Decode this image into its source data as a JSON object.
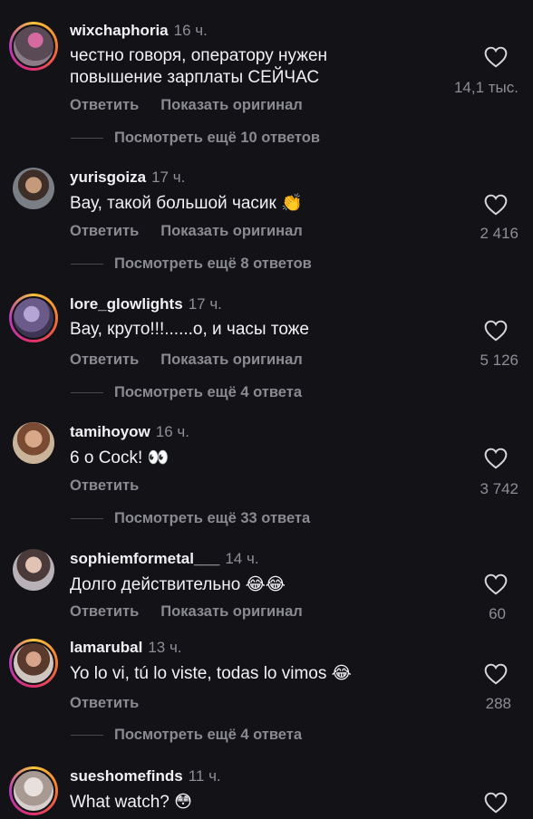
{
  "ui": {
    "reply_label": "Ответить",
    "show_original_label": "Показать оригинал"
  },
  "comments": [
    {
      "username": "wixchaphoria",
      "time": "16 ч.",
      "text": "честно говоря, оператору нужен",
      "text2": "повышение зарплаты СЕЙЧАС",
      "likes": "14,1 тыс.",
      "replies": "Посмотреть ещё 10 ответов"
    },
    {
      "username": "yurisgoiza",
      "time": "17 ч.",
      "text": "Вау, такой большой часик",
      "emoji": "👏",
      "likes": "2 416",
      "replies": "Посмотреть ещё 8 ответов"
    },
    {
      "username": "lore_glowlights",
      "time": "17 ч.",
      "text": "Вау, круто!!!......о, и часы тоже",
      "likes": "5 126",
      "replies": "Посмотреть ещё 4 ответа"
    },
    {
      "username": "tamihoyow",
      "time": "16 ч.",
      "text": "6 о Cock!",
      "emoji": "👀",
      "likes": "3 742",
      "replies": "Посмотреть ещё 33 ответа"
    },
    {
      "username": "sophiemformetal___",
      "time": "14 ч.",
      "text": "Долго действительно",
      "emoji": "😂😂",
      "likes": "60"
    },
    {
      "username": "lamarubal",
      "time": "13 ч.",
      "text": "Yo lo vi, tú lo viste, todas lo vimos",
      "emoji": "😂",
      "likes": "288",
      "replies": "Посмотреть ещё 4 ответа"
    },
    {
      "username": "sueshomefinds",
      "time": "11 ч.",
      "text": "What watch?",
      "emoji": "😳"
    }
  ]
}
